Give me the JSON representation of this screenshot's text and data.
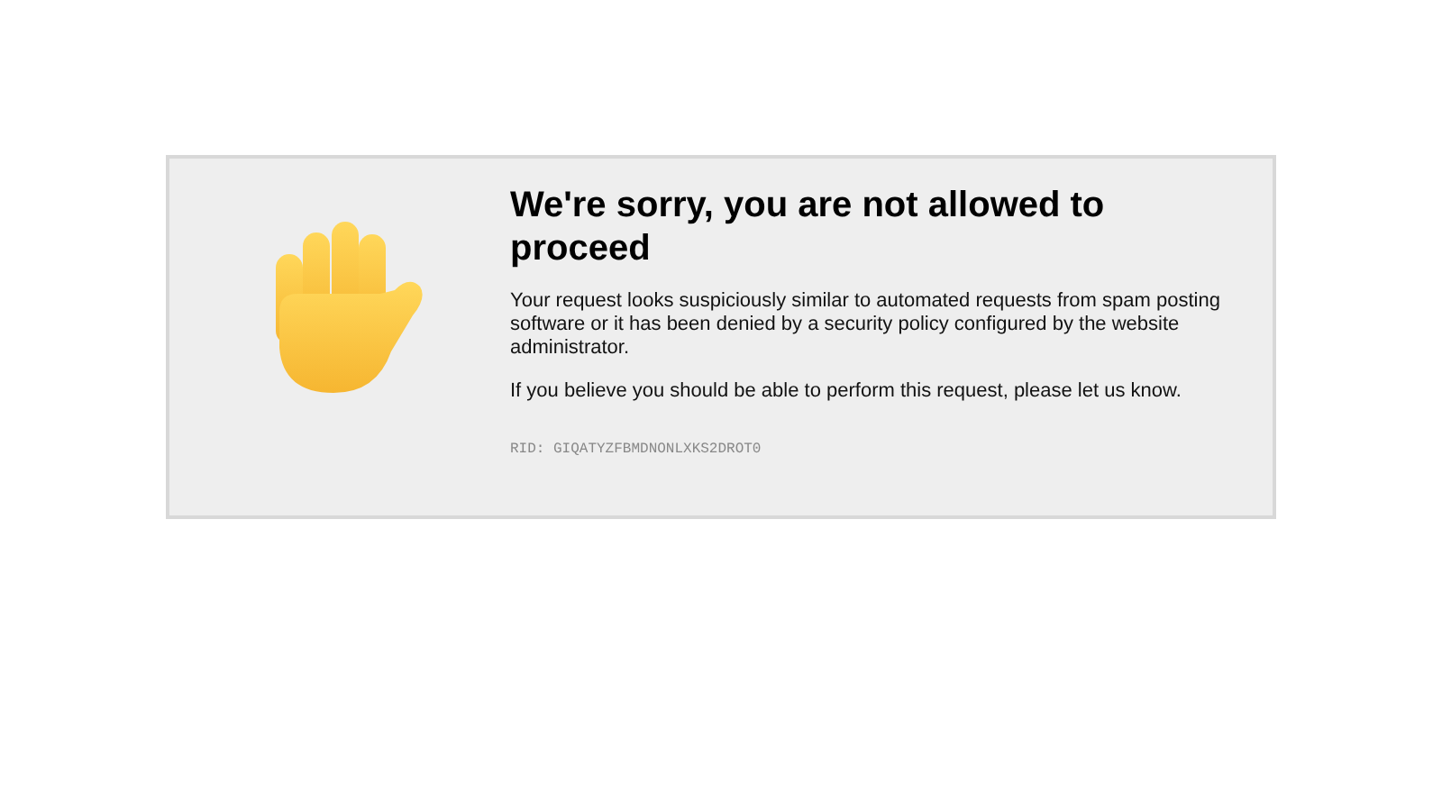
{
  "title": "We're sorry, you are not allowed to proceed",
  "paragraphs": [
    "Your request looks suspiciously similar to automated requests from spam posting software or it has been denied by a security policy configured by the website administrator.",
    "If you believe you should be able to perform this request, please let us know."
  ],
  "rid": "RID: GIQATYZFBMDNONLXKS2DROT0"
}
